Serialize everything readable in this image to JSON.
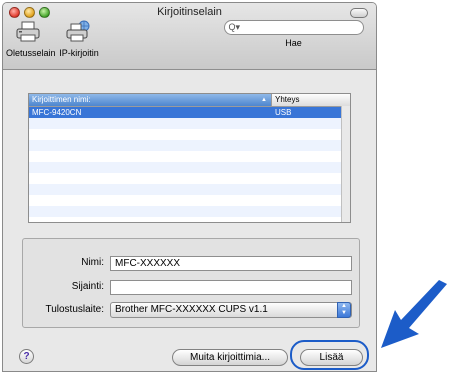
{
  "window": {
    "title": "Kirjoitinselain"
  },
  "toolbar": {
    "default_label": "Oletusselain",
    "default_icon": "printer-icon",
    "ip_label": "IP-kirjoitin",
    "ip_icon": "network-printer-icon",
    "search_placeholder": "",
    "search_label": "Hae"
  },
  "printer_list": {
    "columns": [
      "Kirjoittimen nimi:",
      "Yhteys"
    ],
    "rows": [
      {
        "name": "MFC-9420CN",
        "connection": "USB",
        "selected": true
      }
    ]
  },
  "form": {
    "name_label": "Nimi:",
    "name_value": "MFC-XXXXXX",
    "location_label": "Sijainti:",
    "location_value": "",
    "device_label": "Tulostuslaite:",
    "device_value": "Brother MFC-XXXXXX CUPS v1.1"
  },
  "buttons": {
    "help": "?",
    "more_printers": "Muita kirjoittimia...",
    "add": "Lisää"
  },
  "colors": {
    "selection": "#3875d7",
    "arrow": "#1c5cc8"
  }
}
